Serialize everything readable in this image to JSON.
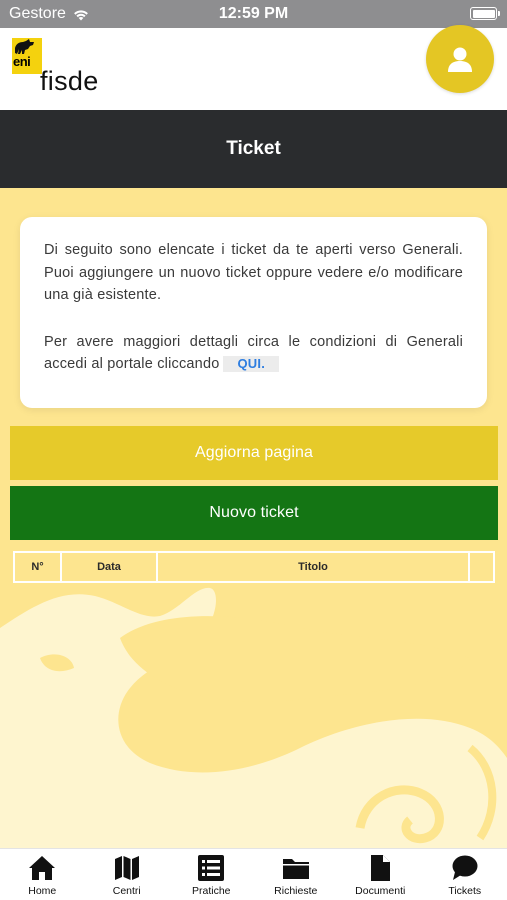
{
  "status_bar": {
    "carrier": "Gestore",
    "time": "12:59 PM"
  },
  "header": {
    "brand_eni": "eni",
    "brand_fisde": "fisde"
  },
  "page": {
    "title": "Ticket"
  },
  "info": {
    "paragraph1": "Di seguito sono elencate i ticket da te aperti verso Generali. Puoi aggiungere un nuovo ticket oppure vedere e/o modificare una già esistente.",
    "paragraph2": "Per avere maggiori dettagli circa le condizioni di Generali accedi al portale cliccando",
    "link_label": "QUI."
  },
  "buttons": {
    "refresh": "Aggiorna pagina",
    "new_ticket": "Nuovo ticket"
  },
  "table": {
    "col_number": "N°",
    "col_date": "Data",
    "col_title": "Titolo"
  },
  "tabs": [
    {
      "label": "Home",
      "icon": "home-icon"
    },
    {
      "label": "Centri",
      "icon": "map-icon"
    },
    {
      "label": "Pratiche",
      "icon": "list-icon"
    },
    {
      "label": "Richieste",
      "icon": "folder-icon"
    },
    {
      "label": "Documenti",
      "icon": "document-icon"
    },
    {
      "label": "Tickets",
      "icon": "chat-icon"
    }
  ],
  "colors": {
    "accent_yellow": "#e6ca2a",
    "new_green": "#147514",
    "title_bar": "#2a2c2e",
    "background": "#fde58f"
  }
}
